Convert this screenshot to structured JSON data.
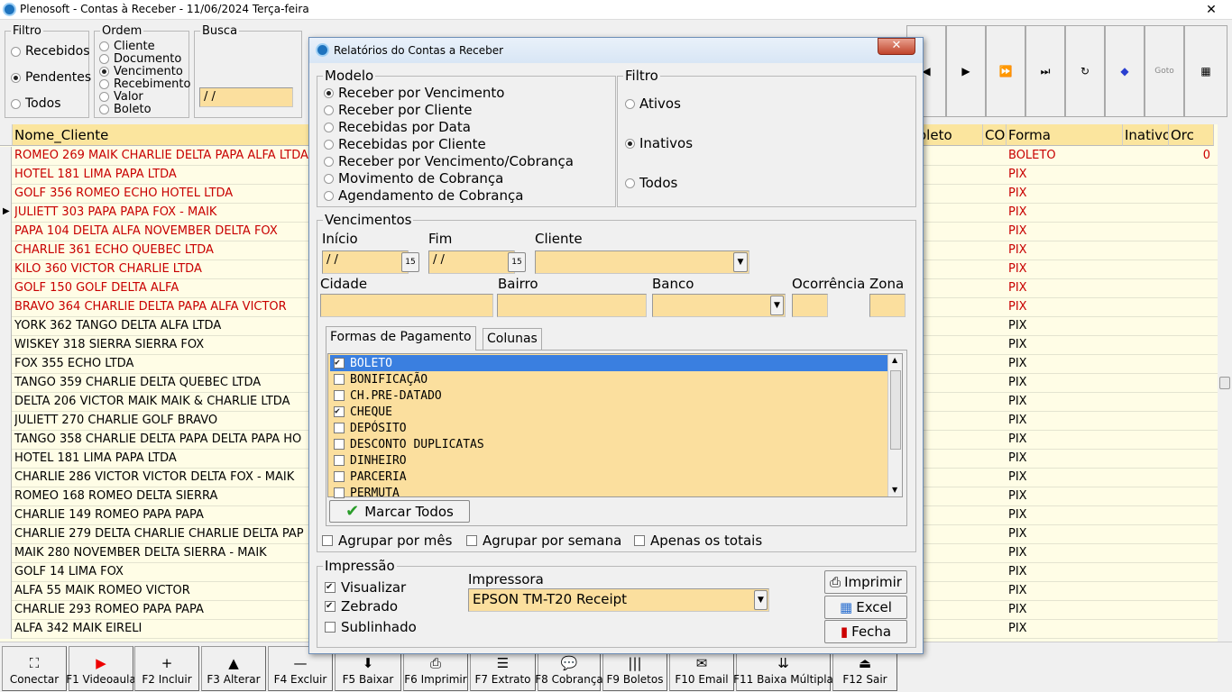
{
  "window": {
    "title": "Plenosoft - Contas à Receber - 11/06/2024 Terça-feira",
    "close_label": "✕"
  },
  "filtro": {
    "legend": "Filtro",
    "options": [
      {
        "label": "Recebidos",
        "selected": false
      },
      {
        "label": "Pendentes",
        "selected": true
      },
      {
        "label": "Todos",
        "selected": false
      }
    ]
  },
  "ordem": {
    "legend": "Ordem",
    "options": [
      {
        "label": "Cliente",
        "selected": false
      },
      {
        "label": "Documento",
        "selected": false
      },
      {
        "label": "Vencimento",
        "selected": true
      },
      {
        "label": "Recebimento",
        "selected": false
      },
      {
        "label": "Valor",
        "selected": false
      },
      {
        "label": "Boleto",
        "selected": false
      }
    ]
  },
  "busca": {
    "legend": "Busca",
    "value": " / /"
  },
  "nav": {
    "icons": [
      "prev-icon",
      "next-icon",
      "fast-forward-icon",
      "last-icon",
      "refresh-icon",
      "bookmark-icon",
      "goto-icon",
      "grid-icon"
    ],
    "glyphs": [
      "◀",
      "▶",
      "⏩",
      "⏭",
      "↻",
      "◆",
      "Goto",
      "▦"
    ]
  },
  "grid": {
    "headers": [
      "Nome_Cliente",
      "oleto",
      "CO",
      "Forma",
      "Inativo",
      "Orc"
    ],
    "rows": [
      {
        "nome": "ROMEO 269 MAIK CHARLIE DELTA PAPA ALFA LTDA",
        "forma": "BOLETO",
        "orc": "0",
        "red": true
      },
      {
        "nome": "HOTEL 181 LIMA PAPA LTDA",
        "forma": "PIX",
        "orc": "",
        "red": true
      },
      {
        "nome": "GOLF 356 ROMEO ECHO HOTEL LTDA",
        "forma": "PIX",
        "orc": "",
        "red": true
      },
      {
        "nome": "JULIETT 303 PAPA PAPA FOX - MAIK",
        "forma": "PIX",
        "orc": "",
        "red": true
      },
      {
        "nome": "PAPA 104 DELTA ALFA NOVEMBER DELTA FOX",
        "forma": "PIX",
        "orc": "",
        "red": true
      },
      {
        "nome": "CHARLIE 361 ECHO QUEBEC LTDA",
        "forma": "PIX",
        "orc": "",
        "red": true
      },
      {
        "nome": "KILO 360 VICTOR CHARLIE LTDA",
        "forma": "PIX",
        "orc": "",
        "red": true
      },
      {
        "nome": "GOLF 150 GOLF DELTA ALFA",
        "forma": "PIX",
        "orc": "",
        "red": true
      },
      {
        "nome": "BRAVO 364 CHARLIE DELTA PAPA ALFA VICTOR",
        "forma": "PIX",
        "orc": "",
        "red": true
      },
      {
        "nome": "YORK 362 TANGO DELTA ALFA LTDA",
        "forma": "PIX",
        "orc": "",
        "red": false
      },
      {
        "nome": "WISKEY 318 SIERRA SIERRA FOX",
        "forma": "PIX",
        "orc": "",
        "red": false
      },
      {
        "nome": "FOX 355 ECHO LTDA",
        "forma": "PIX",
        "orc": "",
        "red": false
      },
      {
        "nome": "TANGO 359 CHARLIE DELTA QUEBEC LTDA",
        "forma": "PIX",
        "orc": "",
        "red": false
      },
      {
        "nome": "DELTA 206 VICTOR MAIK MAIK & CHARLIE LTDA",
        "forma": "PIX",
        "orc": "",
        "red": false
      },
      {
        "nome": "JULIETT 270 CHARLIE GOLF BRAVO",
        "forma": "PIX",
        "orc": "",
        "red": false
      },
      {
        "nome": "TANGO 358 CHARLIE DELTA PAPA DELTA PAPA HO",
        "forma": "PIX",
        "orc": "",
        "red": false
      },
      {
        "nome": "HOTEL 181 LIMA PAPA LTDA",
        "forma": "PIX",
        "orc": "",
        "red": false
      },
      {
        "nome": "CHARLIE 286 VICTOR VICTOR DELTA FOX - MAIK",
        "forma": "PIX",
        "orc": "",
        "red": false
      },
      {
        "nome": "ROMEO 168 ROMEO DELTA SIERRA",
        "forma": "PIX",
        "orc": "",
        "red": false
      },
      {
        "nome": "CHARLIE 149 ROMEO PAPA PAPA",
        "forma": "PIX",
        "orc": "",
        "red": false
      },
      {
        "nome": "CHARLIE 279 DELTA CHARLIE CHARLIE DELTA PAP",
        "forma": "PIX",
        "orc": "",
        "red": false
      },
      {
        "nome": "MAIK 280 NOVEMBER DELTA SIERRA - MAIK",
        "forma": "PIX",
        "orc": "",
        "red": false
      },
      {
        "nome": "GOLF 14 LIMA FOX",
        "forma": "PIX",
        "orc": "",
        "red": false
      },
      {
        "nome": "ALFA 55 MAIK ROMEO VICTOR",
        "forma": "PIX",
        "orc": "",
        "red": false
      },
      {
        "nome": "CHARLIE 293 ROMEO PAPA PAPA",
        "forma": "PIX",
        "orc": "",
        "red": false
      },
      {
        "nome": "ALFA 342 MAIK EIRELI",
        "forma": "PIX",
        "orc": "",
        "red": false
      }
    ]
  },
  "toolbar": [
    {
      "label": "Conectar",
      "icon": "connect-icon",
      "glyph": "⛶"
    },
    {
      "label": "F1 Videoaula",
      "icon": "youtube-icon",
      "glyph": "▶"
    },
    {
      "label": "F2 Incluir",
      "icon": "plus-icon",
      "glyph": "+"
    },
    {
      "label": "F3 Alterar",
      "icon": "up-arrow-icon",
      "glyph": "▲"
    },
    {
      "label": "F4 Excluir",
      "icon": "minus-icon",
      "glyph": "—"
    },
    {
      "label": "F5 Baixar",
      "icon": "download-icon",
      "glyph": "⬇"
    },
    {
      "label": "F6 Imprimir",
      "icon": "printer-icon",
      "glyph": "⎙"
    },
    {
      "label": "F7 Extrato",
      "icon": "list-icon",
      "glyph": "☰"
    },
    {
      "label": "F8 Cobrança",
      "icon": "speech-icon",
      "glyph": "💬"
    },
    {
      "label": "F9 Boletos",
      "icon": "barcode-icon",
      "glyph": "|||"
    },
    {
      "label": "F10 Email",
      "icon": "email-icon",
      "glyph": "✉"
    },
    {
      "label": "F11 Baixa Múltipla",
      "icon": "multi-download-icon",
      "glyph": "⇊"
    },
    {
      "label": "F12 Sair",
      "icon": "exit-icon",
      "glyph": "⏏"
    }
  ],
  "dialog": {
    "title": "Relatórios do Contas a Receber",
    "close_label": "✕",
    "modelo": {
      "legend": "Modelo",
      "options": [
        {
          "label": "Receber por Vencimento",
          "selected": true
        },
        {
          "label": "Receber por Cliente",
          "selected": false
        },
        {
          "label": "Recebidas por Data",
          "selected": false
        },
        {
          "label": "Recebidas por Cliente",
          "selected": false
        },
        {
          "label": "Receber por Vencimento/Cobrança",
          "selected": false
        },
        {
          "label": "Movimento de Cobrança",
          "selected": false
        },
        {
          "label": "Agendamento de Cobrança",
          "selected": false
        }
      ]
    },
    "filtro": {
      "legend": "Filtro",
      "options": [
        {
          "label": "Ativos",
          "selected": false
        },
        {
          "label": "Inativos",
          "selected": true
        },
        {
          "label": "Todos",
          "selected": false
        }
      ]
    },
    "vencimentos": {
      "legend": "Vencimentos",
      "inicio_label": "Início",
      "inicio_value": " / /",
      "fim_label": "Fim",
      "fim_value": " / /",
      "cliente_label": "Cliente",
      "cidade_label": "Cidade",
      "bairro_label": "Bairro",
      "banco_label": "Banco",
      "ocorrencia_label": "Ocorrência",
      "zona_label": "Zona",
      "calendar_glyph": "15"
    },
    "tabs": [
      "Formas de Pagamento",
      "Colunas"
    ],
    "formas": [
      {
        "label": "BOLETO",
        "checked": true,
        "selected": true
      },
      {
        "label": "BONIFICAÇÃO",
        "checked": false,
        "selected": false
      },
      {
        "label": "CH.PRE-DATADO",
        "checked": false,
        "selected": false
      },
      {
        "label": "CHEQUE",
        "checked": true,
        "selected": false
      },
      {
        "label": "DEPÓSITO",
        "checked": false,
        "selected": false
      },
      {
        "label": "DESCONTO DUPLICATAS",
        "checked": false,
        "selected": false
      },
      {
        "label": "DINHEIRO",
        "checked": false,
        "selected": false
      },
      {
        "label": "PARCERIA",
        "checked": false,
        "selected": false
      },
      {
        "label": "PERMUTA",
        "checked": false,
        "selected": false
      }
    ],
    "marcar_todos_label": "Marcar Todos",
    "agrupar_mes_label": "Agrupar por mês",
    "agrupar_semana_label": "Agrupar por semana",
    "apenas_totais_label": "Apenas os totais",
    "impressao": {
      "legend": "Impressão",
      "visualizar_label": "Visualizar",
      "zebrado_label": "Zebrado",
      "sublinhado_label": "Sublinhado",
      "impressora_label": "Impressora",
      "impressora_value": "EPSON TM-T20 Receipt"
    },
    "buttons": {
      "imprimir": "Imprimir",
      "excel": "Excel",
      "fecha": "Fecha"
    }
  },
  "colors": {
    "field_bg": "#fbdf9e",
    "grid_bg": "#fffde6",
    "header_bg": "#fbe59e",
    "red_text": "#c80000",
    "selection": "#3a7fe0"
  }
}
